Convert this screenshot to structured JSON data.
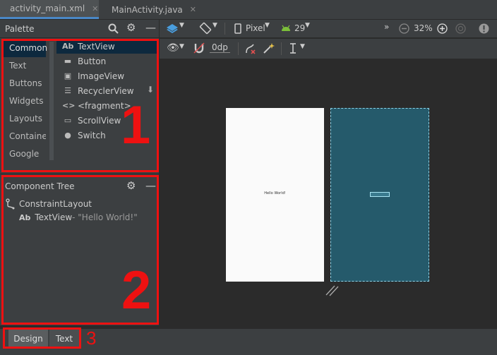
{
  "tabs": [
    {
      "label": "activity_main.xml",
      "active": true
    },
    {
      "label": "MainActivity.java",
      "active": false
    }
  ],
  "palette": {
    "title": "Palette",
    "categories": [
      "Common",
      "Text",
      "Buttons",
      "Widgets",
      "Layouts",
      "Container",
      "Google"
    ],
    "items": [
      {
        "icon": "Ab",
        "label": "TextView"
      },
      {
        "icon": "▬",
        "label": "Button"
      },
      {
        "icon": "▣",
        "label": "ImageView"
      },
      {
        "icon": "☰",
        "label": "RecyclerView"
      },
      {
        "icon": "<>",
        "label": "<fragment>"
      },
      {
        "icon": "▭",
        "label": "ScrollView"
      },
      {
        "icon": "●",
        "label": "Switch"
      }
    ]
  },
  "toolbar": {
    "device": "Pixel",
    "api": "29",
    "zoom": "32%",
    "margin": "0dp",
    "more": "»"
  },
  "component_tree": {
    "title": "Component Tree",
    "root": "ConstraintLayout",
    "child_icon": "Ab",
    "child_label": "TextView",
    "child_value": "- \"Hello World!\""
  },
  "design_surface": {
    "text": "Hello World!"
  },
  "bottom_tabs": [
    "Design",
    "Text"
  ],
  "annotations": {
    "one": "1",
    "two": "2",
    "three": "3"
  },
  "colors": {
    "annotation": "#ee1111",
    "selection": "#0d293e",
    "blueprint": "#255a6b"
  }
}
